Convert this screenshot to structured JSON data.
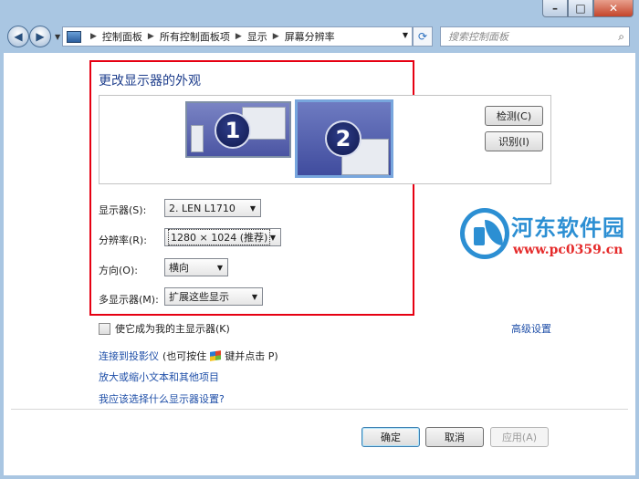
{
  "window": {
    "caption_buttons": {
      "minimize": "–",
      "maximize": "□",
      "close": "✕"
    }
  },
  "navbar": {
    "back_icon": "back-arrow-icon",
    "forward_icon": "forward-arrow-icon",
    "breadcrumb": [
      "控制面板",
      "所有控制面板项",
      "显示",
      "屏幕分辨率"
    ],
    "search_placeholder": "搜索控制面板"
  },
  "main": {
    "heading": "更改显示器的外观",
    "monitors": [
      {
        "number": "1",
        "selected": false
      },
      {
        "number": "2",
        "selected": true
      }
    ],
    "detect_button": "检测(C)",
    "identify_button": "识别(I)",
    "display_label": "显示器(S):",
    "display_value": "2. LEN L1710",
    "resolution_label": "分辨率(R):",
    "resolution_value": "1280 × 1024 (推荐)",
    "orientation_label": "方向(O):",
    "orientation_value": "横向",
    "multi_display_label": "多显示器(M):",
    "multi_display_value": "扩展这些显示",
    "primary_checkbox_label": "使它成为我的主显示器(K)",
    "primary_checked": false,
    "advanced_link": "高级设置",
    "projector_link": "连接到投影仪",
    "projector_hint_prefix": "(也可按住",
    "projector_hint_suffix": "键并点击 P)",
    "text_size_link": "放大或缩小文本和其他项目",
    "which_settings_link": "我应该选择什么显示器设置?"
  },
  "footer": {
    "ok": "确定",
    "cancel": "取消",
    "apply": "应用(A)"
  },
  "watermark": {
    "title": "河东软件园",
    "url": "www.pc0359.cn"
  },
  "colors": {
    "highlight_border": "#e60012",
    "link": "#1f4fa8",
    "heading": "#1e3e8c",
    "watermark_blue": "#2c8fd3",
    "watermark_red": "#e52b2b"
  }
}
